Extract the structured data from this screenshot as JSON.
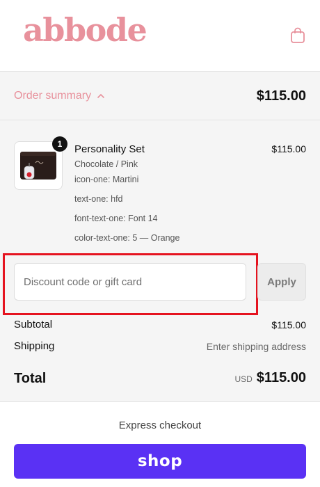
{
  "header": {
    "logo_text": "abbode",
    "cart_icon": "shopping-bag-icon",
    "accent_color": "#e8919c"
  },
  "summary": {
    "toggle_label": "Order summary",
    "toggle_icon": "chevron-up-icon",
    "total": "$115.00"
  },
  "product": {
    "quantity": "1",
    "name": "Personality Set",
    "price": "$115.00",
    "variant": "Chocolate / Pink",
    "properties": [
      "icon-one: Martini",
      "text-one: hfd",
      "font-text-one: Font 14",
      "color-text-one: 5 — Orange"
    ]
  },
  "discount": {
    "placeholder": "Discount code or gift card",
    "value": "",
    "apply_label": "Apply"
  },
  "totals": {
    "subtotal_label": "Subtotal",
    "subtotal_value": "$115.00",
    "shipping_label": "Shipping",
    "shipping_value": "Enter shipping address",
    "total_label": "Total",
    "currency": "USD",
    "total_value": "$115.00"
  },
  "express": {
    "label": "Express checkout",
    "shop_pay_label": "shop",
    "shop_pay_color": "#5a31f4"
  },
  "highlight_color": "#e5131f"
}
